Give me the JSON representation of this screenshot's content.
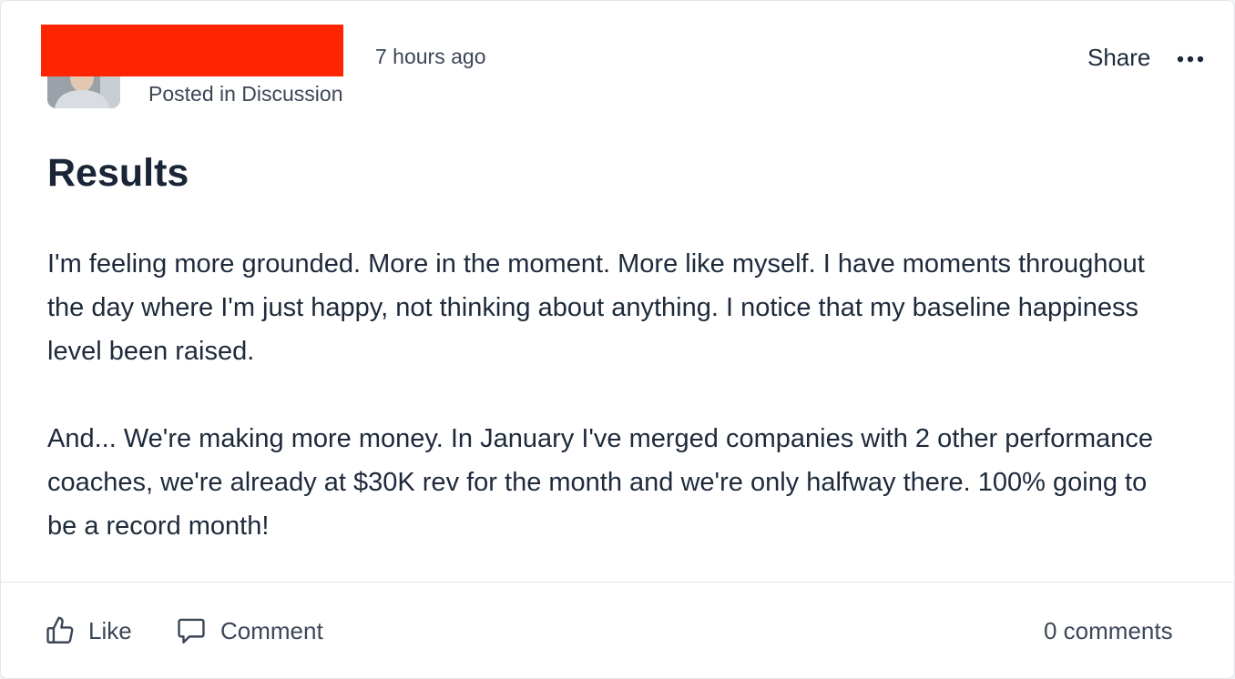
{
  "post": {
    "timestamp": "7 hours ago",
    "posted_in": "Posted in Discussion",
    "share_label": "Share",
    "more_icon": "more-horizontal-icon",
    "title": "Results",
    "paragraphs": [
      "I'm feeling more grounded. More in the moment. More like myself. I have moments throughout the day where I'm just happy, not thinking about anything. I notice that my baseline happiness level been raised.",
      "And... We're making more money. In January I've merged companies with 2 other performance coaches, we're already at $30K rev for the month and we're only halfway there. 100% going to be a record month!"
    ]
  },
  "actions": {
    "like_label": "Like",
    "like_icon": "thumbs-up-icon",
    "comment_label": "Comment",
    "comment_icon": "speech-bubble-icon",
    "comments_count": "0 comments"
  },
  "colors": {
    "text": "#1e2a3b",
    "muted": "#3b4657",
    "redaction": "#ff2500",
    "divider": "#e3e5e8"
  }
}
